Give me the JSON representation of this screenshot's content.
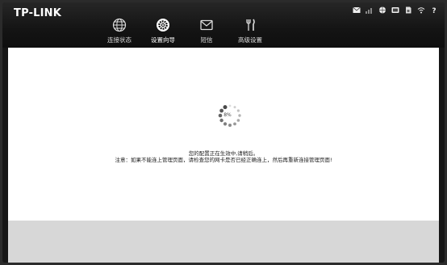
{
  "brand": {
    "logo_text": "TP-LINK"
  },
  "status_icons": [
    "mail-icon",
    "signal-icon",
    "globe-icon",
    "battery-icon",
    "sim-icon",
    "wifi-icon",
    "help-icon"
  ],
  "nav": {
    "items": [
      {
        "label": "连接状态",
        "icon": "globe-icon"
      },
      {
        "label": "设置向导",
        "icon": "gear-icon",
        "active": true
      },
      {
        "label": "短信",
        "icon": "envelope-icon"
      },
      {
        "label": "高级设置",
        "icon": "tools-icon"
      }
    ]
  },
  "progress": {
    "percent_text": "8%"
  },
  "message": {
    "line1": "您的配置正在生效中,请稍后。",
    "line2": "注意：如果不能连上管理页面，请检查您的网卡是否已经正确连上，然后再重新连接管理页面!"
  },
  "colors": {
    "topbar": "#141414",
    "content_bg": "#ffffff",
    "footer_bg": "#d7d7d7"
  }
}
